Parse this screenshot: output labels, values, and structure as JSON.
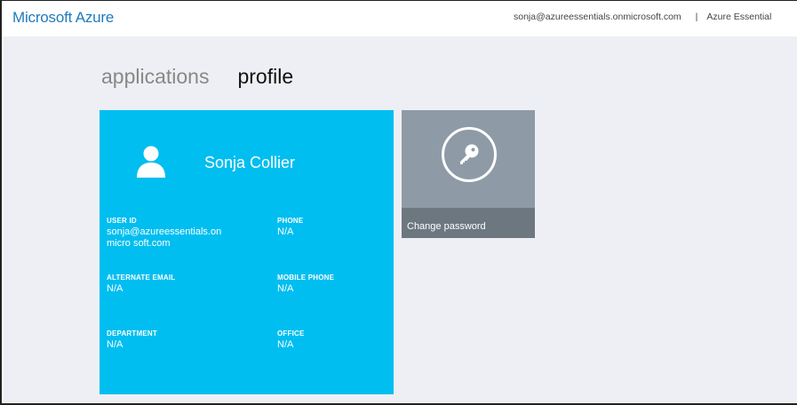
{
  "header": {
    "brand": "Microsoft Azure",
    "user_email": "sonja@azureessentials.onmicrosoft.com",
    "separator": "|",
    "tenant_name": "Azure Essential"
  },
  "tabs": [
    {
      "label": "applications",
      "active": false
    },
    {
      "label": "profile",
      "active": true
    }
  ],
  "profile": {
    "name": "Sonja Collier",
    "fields": {
      "user_id": {
        "label": "USER ID",
        "value": "sonja@azureessentials.onmicro soft.com"
      },
      "phone": {
        "label": "PHONE",
        "value": "N/A"
      },
      "alternate_email": {
        "label": "ALTERNATE EMAIL",
        "value": "N/A"
      },
      "mobile_phone": {
        "label": "MOBILE PHONE",
        "value": "N/A"
      },
      "department": {
        "label": "DEPARTMENT",
        "value": "N/A"
      },
      "office": {
        "label": "OFFICE",
        "value": "N/A"
      }
    }
  },
  "change_password": {
    "label": "Change password",
    "icon": "key-icon"
  },
  "colors": {
    "brand": "#1e7bbf",
    "profile_tile": "#00bef0",
    "password_tile": "#8e9ba6",
    "password_bar": "#6d7780",
    "main_background": "#eeeff4"
  }
}
